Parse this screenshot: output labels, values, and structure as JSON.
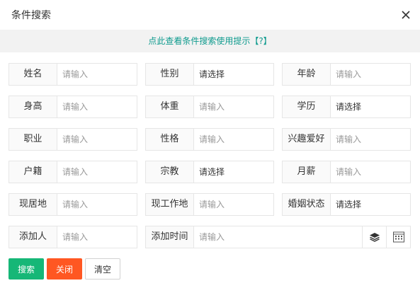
{
  "dialog": {
    "title": "条件搜索",
    "hint_text": "点此查看条件搜索使用提示【?】"
  },
  "fields": [
    {
      "label": "姓名",
      "value": "",
      "placeholder": "请输入"
    },
    {
      "label": "性别",
      "value": "请选择"
    },
    {
      "label": "年龄",
      "value": "",
      "placeholder": "请输入"
    },
    {
      "label": "身高",
      "value": "",
      "placeholder": "请输入"
    },
    {
      "label": "体重",
      "value": "",
      "placeholder": "请输入"
    },
    {
      "label": "学历",
      "value": "请选择"
    },
    {
      "label": "职业",
      "value": "",
      "placeholder": "请输入"
    },
    {
      "label": "性格",
      "value": "",
      "placeholder": "请输入"
    },
    {
      "label": "兴趣爱好",
      "value": "",
      "placeholder": "请输入"
    },
    {
      "label": "户籍",
      "value": "",
      "placeholder": "请输入"
    },
    {
      "label": "宗教",
      "value": "请选择"
    },
    {
      "label": "月薪",
      "value": "",
      "placeholder": "请输入"
    },
    {
      "label": "现居地",
      "value": "",
      "placeholder": "请输入"
    },
    {
      "label": "现工作地",
      "value": "",
      "placeholder": "请输入"
    },
    {
      "label": "婚姻状态",
      "value": "请选择"
    },
    {
      "label": "添加人",
      "value": "",
      "placeholder": "请输入"
    },
    {
      "label": "添加时间",
      "value": "",
      "placeholder": "请输入"
    }
  ],
  "buttons": {
    "search": "搜索",
    "close": "关闭",
    "clear": "清空"
  },
  "icons": {
    "close": "close-icon",
    "layers": "layers-icon",
    "calendar": "calendar-grid-icon"
  },
  "colors": {
    "accent": "#0f9b8e",
    "search_button": "#16b777",
    "close_button": "#ff5722",
    "hint_bar": "#f2f2f2",
    "border": "#e6e6e6"
  }
}
